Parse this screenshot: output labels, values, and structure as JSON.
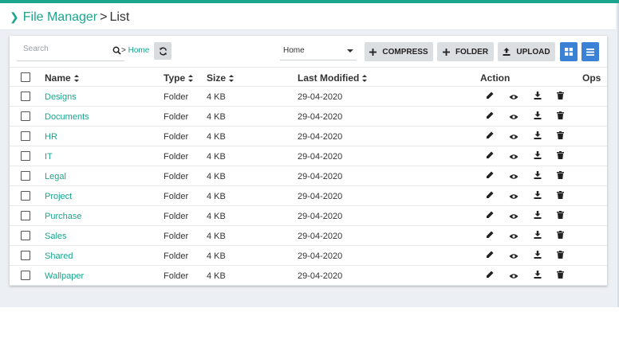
{
  "breadcrumb": {
    "root": "File Manager",
    "separator": ">",
    "current": "List"
  },
  "toolbar": {
    "search_placeholder": "Search",
    "path_prefix": ">",
    "path_home": "Home",
    "location_select": "Home",
    "compress_label": "COMPRESS",
    "folder_label": "FOLDER",
    "upload_label": "UPLOAD"
  },
  "table": {
    "headers": {
      "name": "Name",
      "type": "Type",
      "size": "Size",
      "modified": "Last Modified",
      "action": "Action",
      "ops": "Ops"
    },
    "rows": [
      {
        "name": "Designs",
        "type": "Folder",
        "size": "4 KB",
        "modified": "29-04-2020"
      },
      {
        "name": "Documents",
        "type": "Folder",
        "size": "4 KB",
        "modified": "29-04-2020"
      },
      {
        "name": "HR",
        "type": "Folder",
        "size": "4 KB",
        "modified": "29-04-2020"
      },
      {
        "name": "IT",
        "type": "Folder",
        "size": "4 KB",
        "modified": "29-04-2020"
      },
      {
        "name": "Legal",
        "type": "Folder",
        "size": "4 KB",
        "modified": "29-04-2020"
      },
      {
        "name": "Project",
        "type": "Folder",
        "size": "4 KB",
        "modified": "29-04-2020"
      },
      {
        "name": "Purchase",
        "type": "Folder",
        "size": "4 KB",
        "modified": "29-04-2020"
      },
      {
        "name": "Sales",
        "type": "Folder",
        "size": "4 KB",
        "modified": "29-04-2020"
      },
      {
        "name": "Shared",
        "type": "Folder",
        "size": "4 KB",
        "modified": "29-04-2020"
      },
      {
        "name": "Wallpaper",
        "type": "Folder",
        "size": "4 KB",
        "modified": "29-04-2020"
      }
    ]
  },
  "colors": {
    "accent": "#1aa58c",
    "primary_button": "#3b82d6",
    "button_grey": "#dcdfe2"
  },
  "icons": [
    "chevron-right-icon",
    "search-icon",
    "refresh-icon",
    "caret-down-icon",
    "plus-icon",
    "upload-icon",
    "grid-view-icon",
    "list-view-icon",
    "sort-icon",
    "edit-icon",
    "view-icon",
    "download-icon",
    "delete-icon"
  ]
}
